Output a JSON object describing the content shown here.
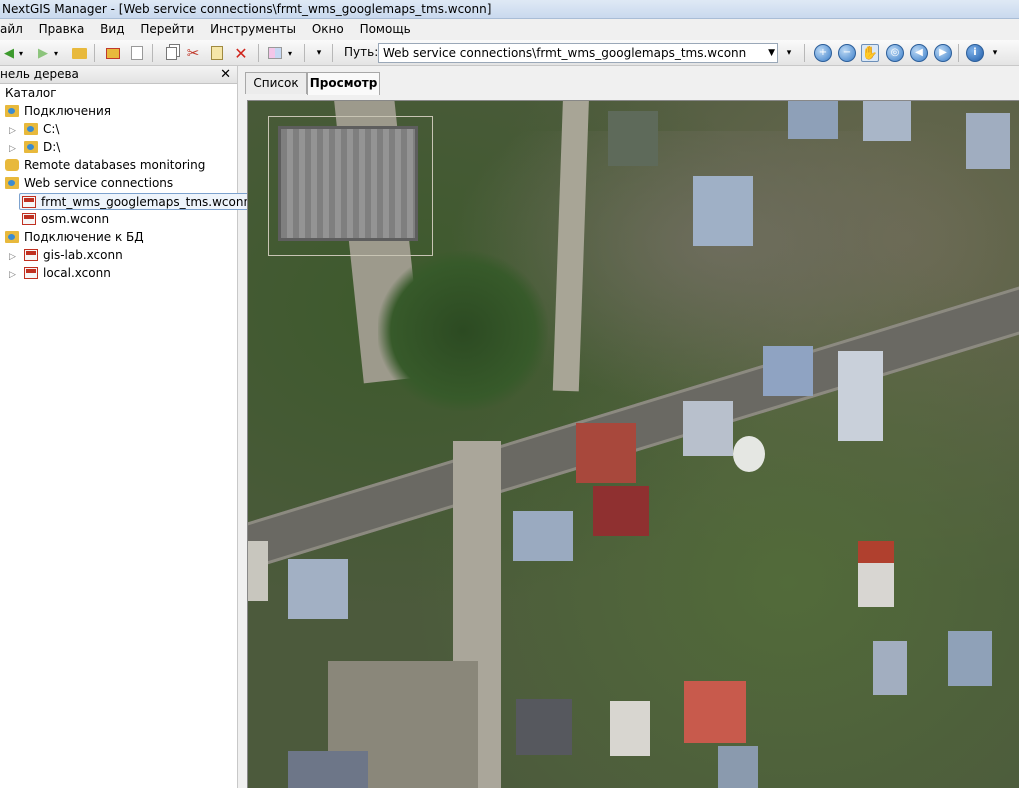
{
  "window": {
    "title": "NextGIS Manager - [Web service connections\\frmt_wms_googlemaps_tms.wconn]"
  },
  "menu": [
    "айл",
    "Правка",
    "Вид",
    "Перейти",
    "Инструменты",
    "Окно",
    "Помощь"
  ],
  "toolbar": {
    "path_label": "Путь:",
    "path_value": "Web service connections\\frmt_wms_googlemaps_tms.wconn",
    "icons": [
      "back-arrow-icon",
      "forward-arrow-icon",
      "folder-up-icon",
      "new-folder-icon",
      "new-item-icon",
      "copy-icon",
      "cut-icon",
      "paste-icon",
      "delete-icon",
      "view-mode-icon",
      "zoom-in-icon",
      "zoom-out-icon",
      "pan-hand-icon",
      "full-extent-icon",
      "prev-extent-icon",
      "next-extent-icon",
      "info-icon"
    ]
  },
  "tree": {
    "header": "нель дерева",
    "close_symbol": "✕",
    "nodes": [
      {
        "label": "Каталог"
      },
      {
        "label": "Подключения"
      },
      {
        "label": "C:\\"
      },
      {
        "label": "D:\\"
      },
      {
        "label": "Remote databases monitoring"
      },
      {
        "label": "Web service connections"
      },
      {
        "label": "frmt_wms_googlemaps_tms.wconn"
      },
      {
        "label": "osm.wconn"
      },
      {
        "label": "Подключение к БД"
      },
      {
        "label": "gis-lab.xconn"
      },
      {
        "label": "local.xconn"
      }
    ]
  },
  "tabs": [
    {
      "label": "Список"
    },
    {
      "label": "Просмотр"
    }
  ],
  "colors": {
    "accent": "#3b7ec9",
    "selection": "#eef4fb",
    "map_ground": "#4a5c38"
  }
}
